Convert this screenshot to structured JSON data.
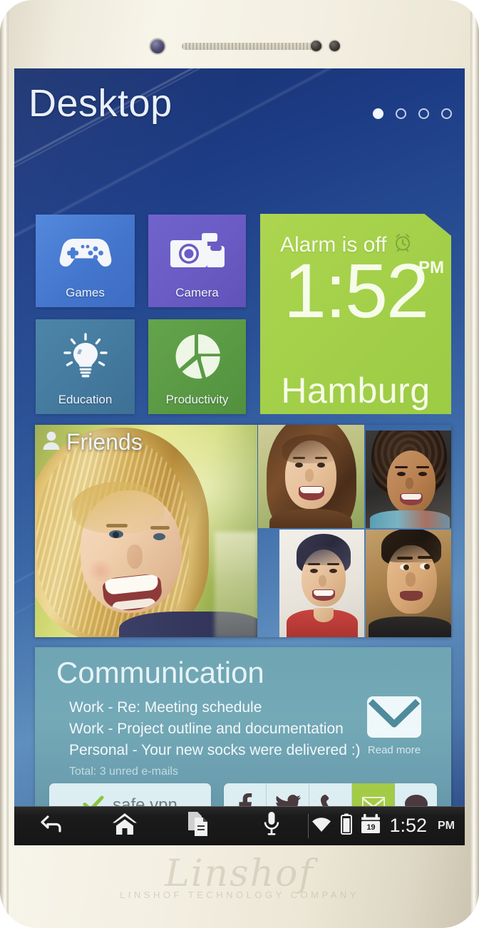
{
  "device": {
    "brand_script": "Linshof",
    "brand_subtitle": "LINSHOF TECHNOLOGY COMPANY",
    "colors": {
      "body": "#f3efe2",
      "screen_bg": "#2a5196"
    }
  },
  "home": {
    "title": "Desktop",
    "page_indicator": {
      "total": 4,
      "active_index": 0
    }
  },
  "tiles": [
    {
      "label": "Games",
      "icon": "gamepad-icon",
      "color": "#4a7fd4"
    },
    {
      "label": "Camera",
      "icon": "camera-icon",
      "color": "#6a5cc4"
    },
    {
      "label": "Education",
      "icon": "lightbulb-icon",
      "color": "#447a9e"
    },
    {
      "label": "Productivity",
      "icon": "piechart-icon",
      "color": "#5a9a44"
    }
  ],
  "clock_widget": {
    "alarm_text": "Alarm is off",
    "alarm_icon": "alarm-clock-icon",
    "time": "1:52",
    "ampm": "PM",
    "city": "Hamburg",
    "color": "#a4d04a"
  },
  "friends_widget": {
    "label": "Friends",
    "icon": "person-icon",
    "photo_count": 5
  },
  "communication": {
    "title": "Communication",
    "messages": [
      "Work - Re: Meeting schedule",
      "Work - Project outline and documentation",
      "Personal - Your new socks were delivered :)"
    ],
    "total_text": "Total: 3 unred e-mails",
    "mail_icon": "envelope-icon",
    "read_more": "Read more",
    "color": "#6fa5b4",
    "vpn": {
      "label": "safe vpn",
      "icon": "check-icon"
    },
    "social": [
      {
        "name": "facebook-icon",
        "active": false
      },
      {
        "name": "twitter-icon",
        "active": false
      },
      {
        "name": "phone-icon",
        "active": false
      },
      {
        "name": "mail-icon",
        "active": true
      },
      {
        "name": "chat-icon",
        "active": false
      }
    ]
  },
  "navbar": {
    "buttons": [
      {
        "name": "back-icon"
      },
      {
        "name": "home-icon"
      },
      {
        "name": "recents-icon"
      },
      {
        "name": "microphone-icon"
      }
    ],
    "status": {
      "wifi_icon": "wifi-icon",
      "battery_icon": "battery-icon",
      "calendar_icon": "calendar-icon",
      "calendar_day": "19",
      "time": "1:52",
      "ampm": "PM"
    }
  }
}
